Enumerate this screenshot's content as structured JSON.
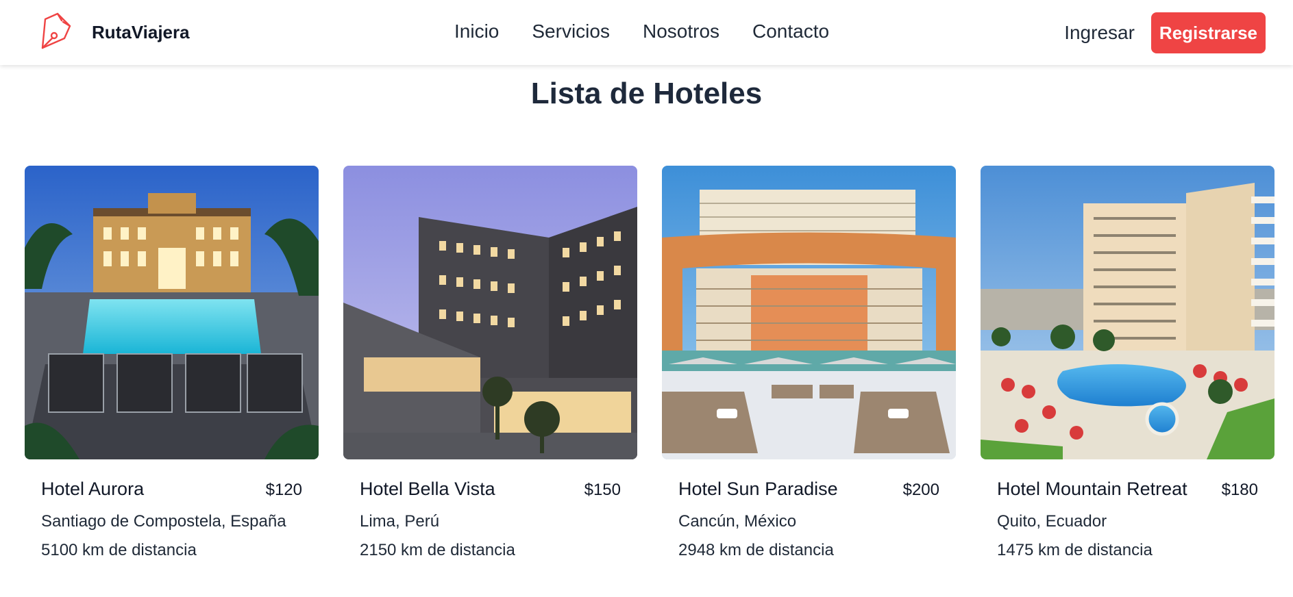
{
  "header": {
    "brand_name": "RutaViajera",
    "logo_icon": "pen-nib-logo-icon",
    "nav": [
      "Inicio",
      "Servicios",
      "Nosotros",
      "Contacto"
    ],
    "login_label": "Ingresar",
    "register_label": "Registrarse"
  },
  "colors": {
    "accent": "#ef4444",
    "title": "#1e293b"
  },
  "main": {
    "title": "Lista de Hoteles",
    "hotels": [
      {
        "name": "Hotel Aurora",
        "price": "$120",
        "location": "Santiago de Compostela, España",
        "distance": "5100 km de distancia"
      },
      {
        "name": "Hotel Bella Vista",
        "price": "$150",
        "location": "Lima, Perú",
        "distance": "2150 km de distancia"
      },
      {
        "name": "Hotel Sun Paradise",
        "price": "$200",
        "location": "Cancún, México",
        "distance": "2948 km de distancia"
      },
      {
        "name": "Hotel Mountain Retreat",
        "price": "$180",
        "location": "Quito, Ecuador",
        "distance": "1475 km de distancia"
      }
    ]
  }
}
